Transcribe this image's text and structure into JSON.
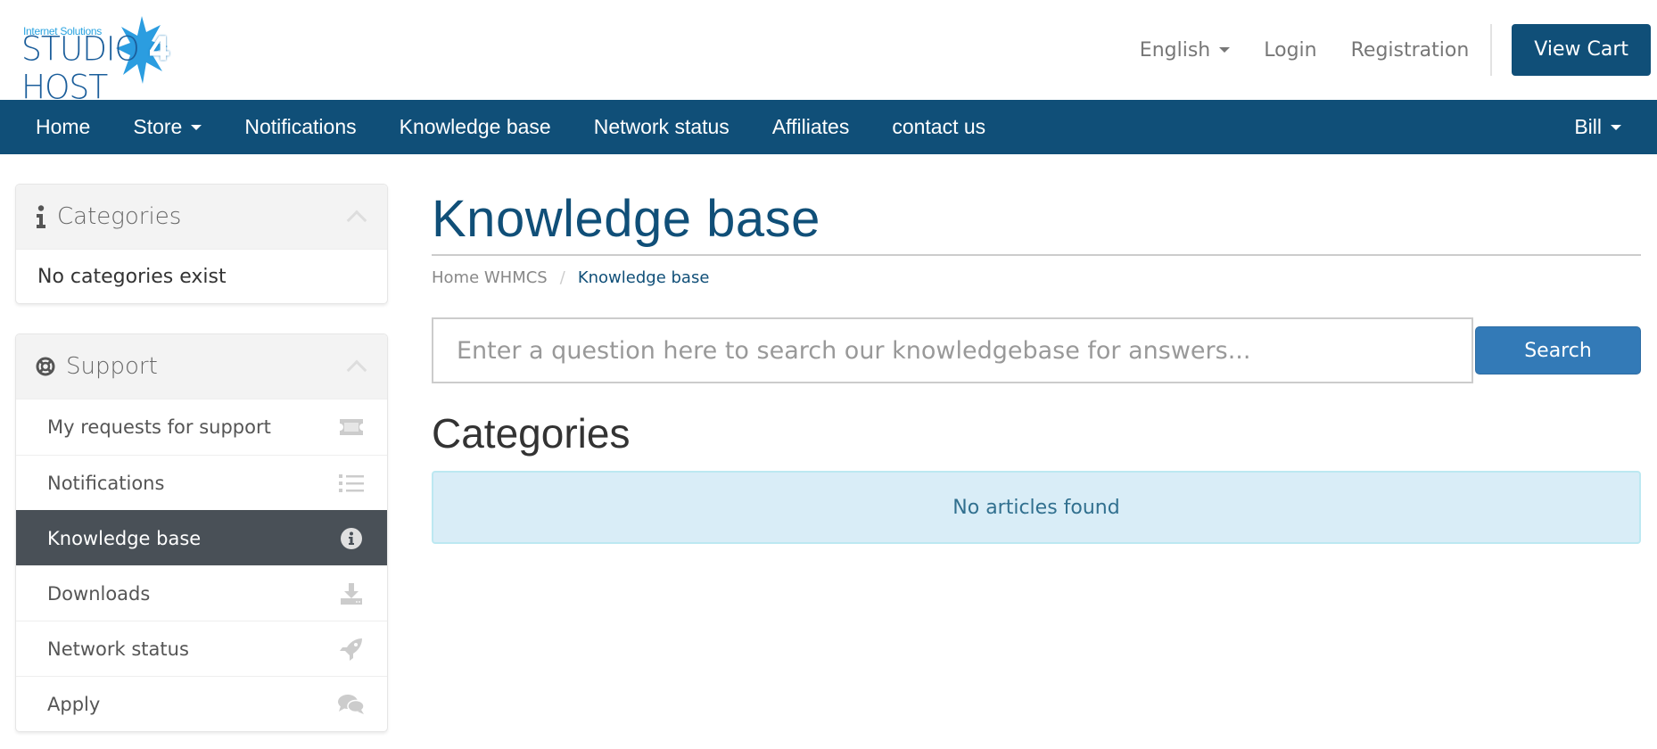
{
  "header": {
    "logo": {
      "tagline": "Internet Solutions",
      "wordmark_left": "STUDIO",
      "wordmark_num": "4",
      "wordmark_right": "HOST"
    },
    "language": "English",
    "login": "Login",
    "registration": "Registration",
    "view_cart": "View Cart"
  },
  "nav": {
    "items": [
      {
        "label": "Home",
        "has_caret": false
      },
      {
        "label": "Store",
        "has_caret": true
      },
      {
        "label": "Notifications",
        "has_caret": false
      },
      {
        "label": "Knowledge base",
        "has_caret": false
      },
      {
        "label": "Network status",
        "has_caret": false
      },
      {
        "label": "Affiliates",
        "has_caret": false
      },
      {
        "label": "contact us",
        "has_caret": false
      }
    ],
    "user": "Bill"
  },
  "sidebar": {
    "categories_panel": {
      "title": "Categories",
      "icon": "info-icon",
      "empty_text": "No categories exist"
    },
    "support_panel": {
      "title": "Support",
      "icon": "life-ring-icon",
      "items": [
        {
          "label": "My requests for support",
          "icon": "ticket-icon",
          "active": false
        },
        {
          "label": "Notifications",
          "icon": "list-icon",
          "active": false
        },
        {
          "label": "Knowledge base",
          "icon": "info-circle-icon",
          "active": true
        },
        {
          "label": "Downloads",
          "icon": "download-icon",
          "active": false
        },
        {
          "label": "Network status",
          "icon": "rocket-icon",
          "active": false
        },
        {
          "label": "Apply",
          "icon": "comments-icon",
          "active": false
        }
      ]
    }
  },
  "main": {
    "title": "Knowledge base",
    "breadcrumb": {
      "home": "Home WHMCS",
      "separator": "/",
      "current": "Knowledge base"
    },
    "search": {
      "placeholder": "Enter a question here to search our knowledgebase for answers...",
      "value": "",
      "button": "Search"
    },
    "categories_title": "Categories",
    "empty_message": "No articles found"
  },
  "colors": {
    "brand": "#104f78",
    "primary_button": "#337ab7",
    "active_item": "#495057",
    "info_bg": "#d9edf7",
    "info_text": "#31708f"
  }
}
